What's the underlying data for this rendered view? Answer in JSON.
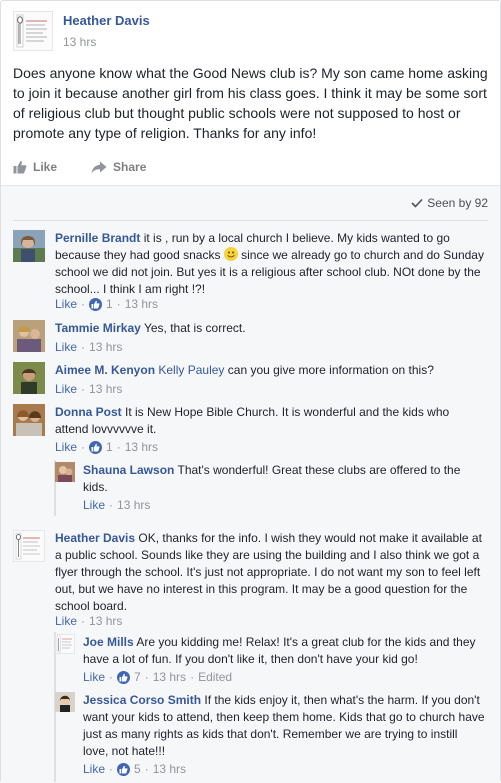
{
  "post": {
    "author": "Heather Davis",
    "time": "13 hrs",
    "text": "Does anyone know what the Good News club is? My son came home asking to join it because another girl from his class goes. I think it may be some sort of religious club but thought public schools were not supposed to host or promote any type of religion. Thanks for any info!",
    "like_label": "Like",
    "share_label": "Share",
    "seen_by": "Seen by 92"
  },
  "comments": [
    {
      "name": "Pernille Brandt",
      "text_a": "it is , run by a local church I believe. My kids wanted to go because they had good snacks",
      "text_b": "since we already go to church and do Sunday school we did not join. But yes it is a religious after school club. NOt done by the school... I think I am right !?!",
      "like": "Like",
      "likes": "1",
      "time": "13 hrs"
    },
    {
      "name": "Tammie Mirkay",
      "text": "Yes, that is correct.",
      "like": "Like",
      "time": "13 hrs"
    },
    {
      "name": "Aimee M. Kenyon",
      "tag": "Kelly Pauley",
      "text": "can you give more information on this?",
      "like": "Like",
      "time": "13 hrs"
    },
    {
      "name": "Donna Post",
      "text": "It is New Hope Bible Church. It is wonderful and the kids who attend lovvvvvve it.",
      "like": "Like",
      "likes": "1",
      "time": "13 hrs"
    },
    {
      "name": "Shauna Lawson",
      "text": "That's wonderful! Great these clubs are offered to the kids.",
      "like": "Like",
      "time": "13 hrs"
    },
    {
      "name": "Heather Davis",
      "text": "OK, thanks for the info. I wish they would not make it available at a public school. Sounds like they are using the building and I also think we got a flyer through the school. It's just not appropriate. I do not want my son to feel left out, but we have no interest in this program. It may be a good question for the school board.",
      "like": "Like",
      "time": "13 hrs"
    },
    {
      "name": "Joe Mills",
      "text": "Are you kidding me! Relax! It's a great club for the kids and they have a lot of fun. If you don't like it, then don't have your kid go!",
      "like": "Like",
      "likes": "7",
      "time": "13 hrs",
      "edited": "Edited"
    },
    {
      "name": "Jessica Corso Smith",
      "text": "If the kids enjoy it, then what's the harm. If you don't want your kids to attend, then keep them home. Kids that go to church have just as many rights as kids that don't. Remember we are trying to instill love, not hate!!!",
      "like": "Like",
      "likes": "5",
      "time": "13 hrs"
    }
  ],
  "separator": "·",
  "colors": {
    "name_link": "#365899",
    "meta": "#90949c",
    "like_blue": "#4267b2",
    "comments_bg": "#f6f7f9"
  }
}
